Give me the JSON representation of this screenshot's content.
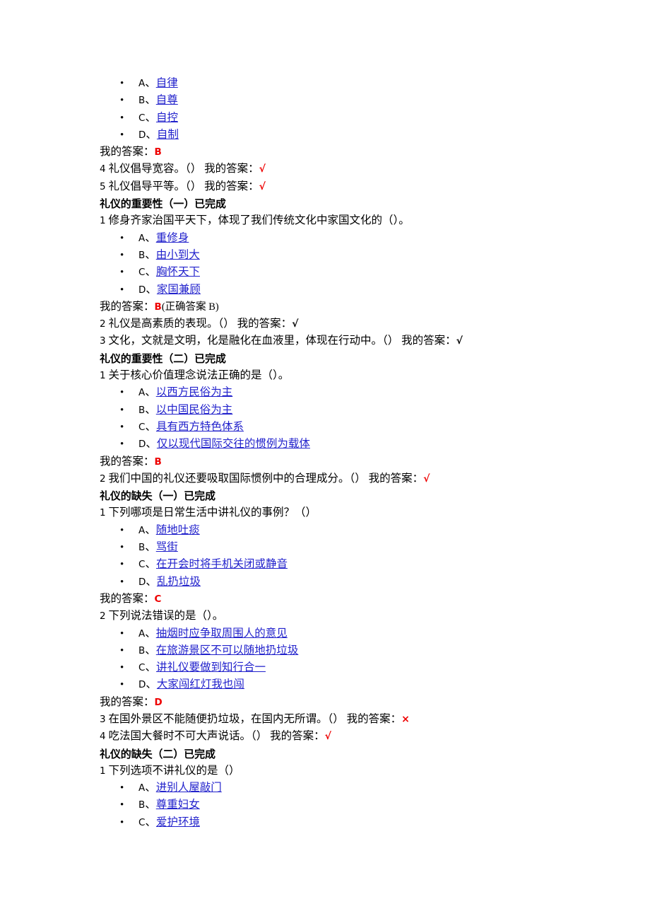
{
  "document": {
    "link_color": "#2222cc",
    "answer_red": "#ee0000",
    "answer_label": "我的答案：",
    "bullet_glyph": "•",
    "separator": "、",
    "check_mark": "√",
    "cross_mark": "×"
  },
  "blocks": [
    {
      "type": "options",
      "items": [
        {
          "letter": "A",
          "text": "自律"
        },
        {
          "letter": "B",
          "text": "自尊"
        },
        {
          "letter": "C",
          "text": "自控"
        },
        {
          "letter": "D",
          "text": "自制"
        }
      ]
    },
    {
      "type": "answer",
      "label": "我的答案：",
      "value": "B",
      "color": "red"
    },
    {
      "type": "tf",
      "num": "4",
      "text": "礼仪倡导宽容。（）",
      "label": "我的答案：",
      "mark": "√",
      "color": "red"
    },
    {
      "type": "tf",
      "num": "5",
      "text": "礼仪倡导平等。（）",
      "label": "我的答案：",
      "mark": "√",
      "color": "red"
    },
    {
      "type": "section",
      "title": "礼仪的重要性（一）已完成"
    },
    {
      "type": "question",
      "num": "1",
      "text": "修身齐家治国平天下，体现了我们传统文化中家国文化的（）。"
    },
    {
      "type": "options",
      "items": [
        {
          "letter": "A",
          "text": "重修身"
        },
        {
          "letter": "B",
          "text": "由小到大"
        },
        {
          "letter": "C",
          "text": "胸怀天下"
        },
        {
          "letter": "D",
          "text": "家国兼顾"
        }
      ]
    },
    {
      "type": "answer",
      "label": "我的答案：",
      "value": "B",
      "color": "red",
      "note": "(正确答案 B)"
    },
    {
      "type": "tf",
      "num": "2",
      "text": "礼仪是高素质的表现。（）",
      "label": "我的答案：",
      "mark": "√",
      "color": "black"
    },
    {
      "type": "tf",
      "num": "3",
      "text": "文化，文就是文明，化是融化在血液里，体现在行动中。（）",
      "label": "我的答案：",
      "mark": "√",
      "color": "black"
    },
    {
      "type": "section",
      "title": "礼仪的重要性（二）已完成"
    },
    {
      "type": "question",
      "num": "1",
      "text": "关于核心价值理念说法正确的是（）。"
    },
    {
      "type": "options",
      "items": [
        {
          "letter": "A",
          "text": "以西方民俗为主"
        },
        {
          "letter": "B",
          "text": "以中国民俗为主"
        },
        {
          "letter": "C",
          "text": "具有西方特色体系"
        },
        {
          "letter": "D",
          "text": "仅以现代国际交往的惯例为载体"
        }
      ]
    },
    {
      "type": "answer",
      "label": "我的答案：",
      "value": "B",
      "color": "red"
    },
    {
      "type": "tf",
      "num": "2",
      "text": "我们中国的礼仪还要吸取国际惯例中的合理成分。（）",
      "label": "我的答案：",
      "mark": "√",
      "color": "red"
    },
    {
      "type": "section",
      "title": "礼仪的缺失（一）已完成"
    },
    {
      "type": "question",
      "num": "1",
      "text": "下列哪项是日常生活中讲礼仪的事例？（）"
    },
    {
      "type": "options",
      "items": [
        {
          "letter": "A",
          "text": "随地吐痰"
        },
        {
          "letter": "B",
          "text": "骂街"
        },
        {
          "letter": "C",
          "text": "在开会时将手机关闭或静音"
        },
        {
          "letter": "D",
          "text": "乱扔垃圾"
        }
      ]
    },
    {
      "type": "answer",
      "label": "我的答案：",
      "value": "C",
      "color": "red"
    },
    {
      "type": "question",
      "num": "2",
      "text": "下列说法错误的是（）。"
    },
    {
      "type": "options",
      "items": [
        {
          "letter": "A",
          "text": "抽烟时应争取周围人的意见"
        },
        {
          "letter": "B",
          "text": "在旅游景区不可以随地扔垃圾"
        },
        {
          "letter": "C",
          "text": "讲礼仪要做到知行合一"
        },
        {
          "letter": "D",
          "text": "大家闯红灯我也闯"
        }
      ]
    },
    {
      "type": "answer",
      "label": "我的答案：",
      "value": "D",
      "color": "red"
    },
    {
      "type": "tf",
      "num": "3",
      "text": "在国外景区不能随便扔垃圾，在国内无所谓。（）",
      "label": "我的答案：",
      "mark": "×",
      "color": "red"
    },
    {
      "type": "tf",
      "num": "4",
      "text": "吃法国大餐时不可大声说话。（）",
      "label": "我的答案：",
      "mark": "√",
      "color": "red"
    },
    {
      "type": "section",
      "title": "礼仪的缺失（二）已完成"
    },
    {
      "type": "question",
      "num": "1",
      "text": "下列选项不讲礼仪的是（）"
    },
    {
      "type": "options",
      "items": [
        {
          "letter": "A",
          "text": "进别人屋敲门"
        },
        {
          "letter": "B",
          "text": "尊重妇女"
        },
        {
          "letter": "C",
          "text": "爱护环境"
        }
      ]
    }
  ]
}
